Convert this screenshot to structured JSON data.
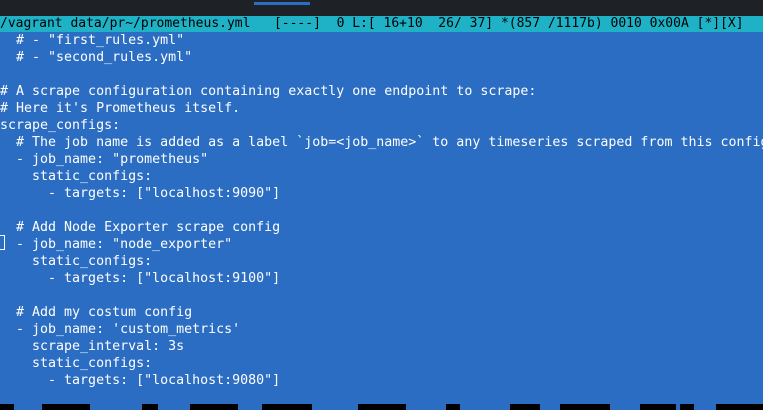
{
  "status_bar": {
    "filepath": "/vagrant data/pr~/prometheus.yml",
    "mode": "[----]",
    "col": "0",
    "line_pos": "L:[ 16+10  26/ 37]",
    "char_pos": "*(857 /1117b)",
    "char_code": "0010 0x00A",
    "flags": "[*][X]"
  },
  "editor": {
    "lines": [
      "  # - \"first_rules.yml\"",
      "  # - \"second_rules.yml\"",
      "",
      "# A scrape configuration containing exactly one endpoint to scrape:",
      "# Here it's Prometheus itself.",
      "scrape_configs:",
      "  # The job name is added as a label `job=<job_name>` to any timeseries scraped from this config.",
      "  - job_name: \"prometheus\"",
      "    static_configs:",
      "      - targets: [\"localhost:9090\"]",
      "",
      "  # Add Node Exporter scrape config",
      "  - job_name: \"node_exporter\"",
      "    static_configs:",
      "      - targets: [\"localhost:9100\"]",
      "",
      "  # Add my costum config",
      "  - job_name: 'custom_metrics'",
      "    scrape_interval: 3s",
      "    static_configs:",
      "      - targets: [\"localhost:9080\"]"
    ]
  },
  "colors": {
    "editor_bg": "#2b6dc2",
    "status_bg": "#1fb2c6",
    "text": "#ffffff",
    "frame": "#1e2126"
  }
}
